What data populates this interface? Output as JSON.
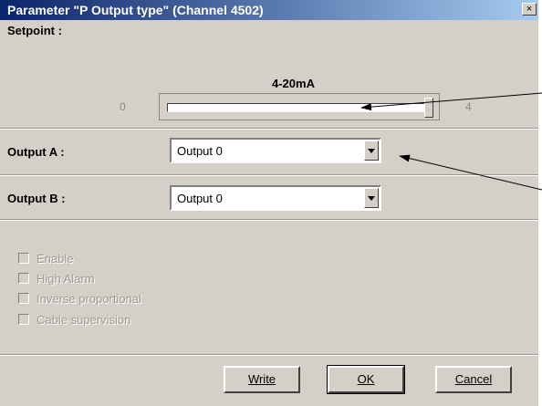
{
  "window": {
    "title": "Parameter \"P Output type\" (Channel 4502)",
    "close_glyph": "×"
  },
  "setpoint": {
    "label": "Setpoint :",
    "value_label": "4-20mA",
    "range_min": "0",
    "range_max": "4",
    "level": 1.0
  },
  "output_a": {
    "label": "Output A :",
    "value": "Output 0"
  },
  "output_b": {
    "label": "Output B :",
    "value": "Output 0"
  },
  "checkboxes": [
    {
      "label": "Enable",
      "checked": false,
      "disabled": true
    },
    {
      "label": "High Alarm",
      "checked": false,
      "disabled": true
    },
    {
      "label": "Inverse proportional",
      "checked": false,
      "disabled": true
    },
    {
      "label": "Cable supervision",
      "checked": false,
      "disabled": true
    }
  ],
  "buttons": {
    "write": "Write",
    "ok": "OK",
    "cancel": "Cancel"
  },
  "icons": [
    "close-icon",
    "dropdown-arrow-icon",
    "checkbox-icon"
  ]
}
